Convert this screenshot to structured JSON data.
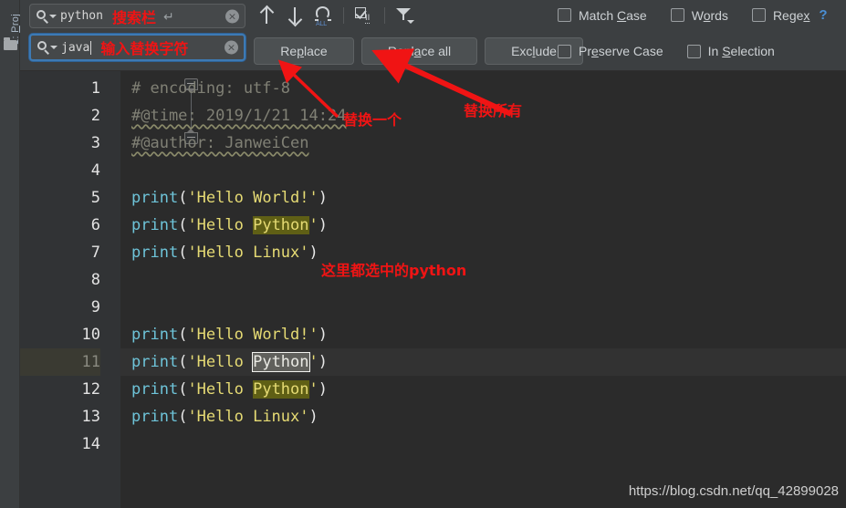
{
  "sidebar": {
    "tool_label_prefix": "1: ",
    "tool_label_underline": "P",
    "tool_label_rest": "roj",
    "folder_icon": "folder-icon"
  },
  "find_bar": {
    "search_field": {
      "value": "python",
      "annotation": "搜索栏",
      "enter_icon": "↵",
      "clear_icon": "×",
      "magnifier_icon": "search-icon"
    },
    "replace_field": {
      "value": "java",
      "annotation": "输入替换字符",
      "clear_icon": "×",
      "magnifier_icon": "search-icon"
    },
    "nav_icons": [
      {
        "name": "find-previous-icon",
        "title": "↑"
      },
      {
        "name": "find-next-icon",
        "title": "↓"
      },
      {
        "name": "select-all-occurrences-icon",
        "title": "ALL"
      },
      {
        "name": "add-selection-icon",
        "title": "II"
      },
      {
        "name": "filter-icon",
        "title": "filter"
      }
    ],
    "buttons": [
      {
        "name": "replace-button",
        "pre": "Re",
        "underline": "p",
        "post": "lace"
      },
      {
        "name": "replace-all-button",
        "pre": "Repl",
        "underline": "a",
        "post": "ce all"
      },
      {
        "name": "exclude-button",
        "pre": "Exc",
        "underline": "l",
        "post": "ude"
      }
    ],
    "checkboxes_row1": [
      {
        "name": "match-case-checkbox",
        "pre": "Match ",
        "underline": "C",
        "post": "ase",
        "checked": false
      },
      {
        "name": "words-checkbox",
        "pre": "W",
        "underline": "o",
        "post": "rds",
        "checked": false
      },
      {
        "name": "regex-checkbox",
        "pre": "Rege",
        "underline": "x",
        "post": "",
        "checked": false
      }
    ],
    "help_label": "?",
    "checkboxes_row2": [
      {
        "name": "preserve-case-checkbox",
        "pre": "Pr",
        "underline": "e",
        "post": "serve Case",
        "checked": false
      },
      {
        "name": "in-selection-checkbox",
        "pre": "In ",
        "underline": "S",
        "post": "election",
        "checked": false
      }
    ]
  },
  "editor": {
    "line_numbers": [
      "1",
      "2",
      "3",
      "4",
      "5",
      "6",
      "7",
      "8",
      "9",
      "10",
      "11",
      "12",
      "13",
      "14"
    ],
    "current_line": 11,
    "lines": [
      {
        "n": 1,
        "type": "comment",
        "text": "# encoding: utf-8"
      },
      {
        "n": 2,
        "type": "comment-squiggle",
        "text": "#@time: 2019/1/21 14:24"
      },
      {
        "n": 3,
        "type": "comment-squiggle",
        "text": "#@author: JanweiCen"
      },
      {
        "n": 4,
        "type": "blank",
        "text": ""
      },
      {
        "n": 5,
        "type": "print",
        "arg": "Hello World!",
        "match": null
      },
      {
        "n": 6,
        "type": "print",
        "arg": "Hello Python",
        "match": "Python"
      },
      {
        "n": 7,
        "type": "print",
        "arg": "Hello Linux",
        "match": null
      },
      {
        "n": 8,
        "type": "blank",
        "text": ""
      },
      {
        "n": 9,
        "type": "blank",
        "text": ""
      },
      {
        "n": 10,
        "type": "print",
        "arg": "Hello World!",
        "match": null
      },
      {
        "n": 11,
        "type": "print",
        "arg": "Hello Python",
        "match": "Python",
        "active_match": true
      },
      {
        "n": 12,
        "type": "print",
        "arg": "Hello Python",
        "match": "Python"
      },
      {
        "n": 13,
        "type": "print",
        "arg": "Hello Linux",
        "match": null
      },
      {
        "n": 14,
        "type": "blank",
        "text": ""
      }
    ],
    "watermark": "https://blog.csdn.net/qq_42899028"
  },
  "annotations": [
    {
      "name": "annotation-replace-one",
      "text": "替换一个"
    },
    {
      "name": "annotation-replace-all",
      "text": "替换所有"
    },
    {
      "name": "annotation-matches",
      "text": "这里都选中的python"
    }
  ],
  "colors": {
    "toolbar_bg": "#3c3f41",
    "editor_bg": "#2b2b2b",
    "gutter_bg": "#313335",
    "keyword": "#6ec4d9",
    "string": "#e6db74",
    "comment": "#808075",
    "match_highlight": "#5f5f15",
    "active_match": "#60605c",
    "annotation_red": "#f01414",
    "focus_blue": "#3d7ab5"
  }
}
